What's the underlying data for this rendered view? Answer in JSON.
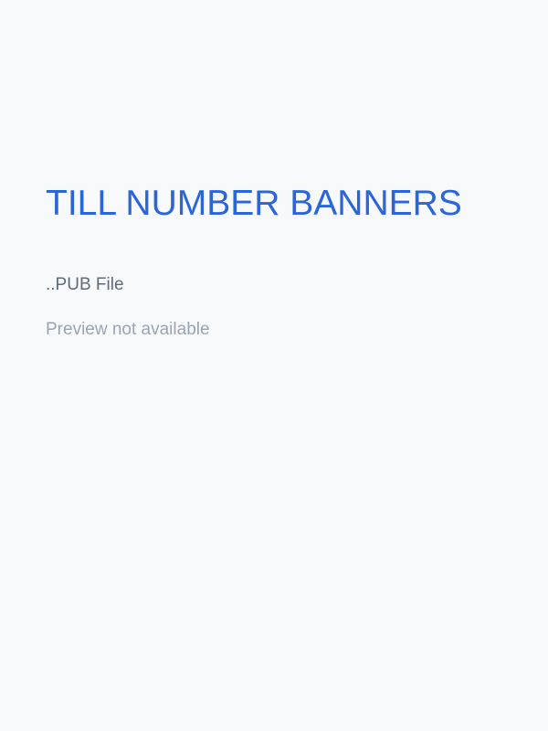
{
  "document": {
    "title": "TILL NUMBER BANNERS",
    "file_type": "..PUB File",
    "preview_message": "Preview not available"
  },
  "colors": {
    "background": "#f8f9fa",
    "title": "#2a66d9",
    "file_type": "#5f6b7a",
    "preview_message": "#9aa5b1"
  }
}
